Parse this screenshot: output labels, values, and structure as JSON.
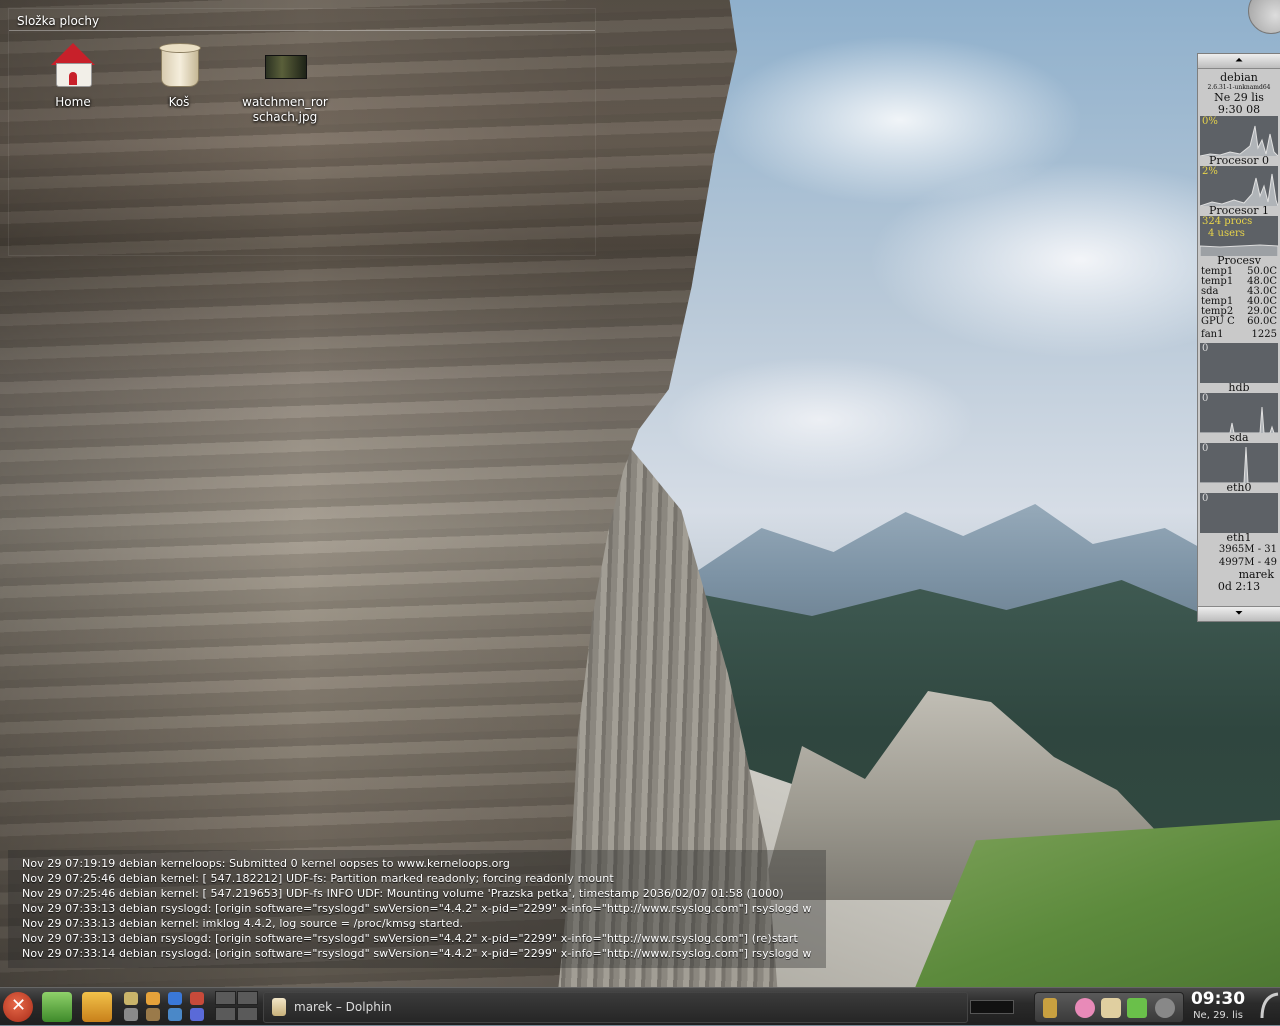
{
  "desktop": {
    "folderview_title": "Složka plochy",
    "icons": [
      {
        "label": "Home",
        "icon": "home-icon"
      },
      {
        "label": "Koš",
        "icon": "trash-icon"
      },
      {
        "label": "watchmen_rorschach.jpg",
        "icon": "image-file-icon"
      }
    ]
  },
  "monitor": {
    "hostname": "debian",
    "kernel": "2.6.31-1-unknamd64",
    "date": "Ne 29 lis",
    "time": "9:30 08",
    "cpu0_percent": "0%",
    "cpu0_caption": "Procesor 0",
    "cpu1_percent": "2%",
    "cpu1_caption": "Procesor 1",
    "procs": "324 procs",
    "users": "4 users",
    "procs_caption": "Procesv",
    "sensors": [
      {
        "name": "temp1",
        "value": "50.0C"
      },
      {
        "name": "temp1",
        "value": "48.0C"
      },
      {
        "name": "sda",
        "value": "43.0C"
      },
      {
        "name": "temp1",
        "value": "40.0C"
      },
      {
        "name": "temp2",
        "value": "29.0C"
      },
      {
        "name": "GPU C",
        "value": "60.0C"
      },
      {
        "name": "fan1",
        "value": "1225"
      }
    ],
    "graph_hdb_value": "0",
    "graph_hdb_caption": "hdb",
    "graph_sda_value": "0",
    "graph_sda_caption": "sda",
    "graph_eth0_value": "0",
    "graph_eth0_caption": "eth0",
    "graph_eth1_value": "0",
    "graph_eth1_caption": "eth1",
    "mem1": "3965M - 31",
    "mem2": "4997M - 49",
    "user": "marek",
    "uptime": "0d  2:13"
  },
  "log": {
    "lines": [
      "Nov 29 07:19:19 debian kerneloops: Submitted 0 kernel oopses to www.kerneloops.org",
      "Nov 29 07:25:46 debian kernel: [  547.182212] UDF-fs: Partition marked readonly; forcing readonly mount",
      "Nov 29 07:25:46 debian kernel: [  547.219653] UDF-fs INFO UDF: Mounting volume 'Prazska petka', timestamp 2036/02/07 01:58 (1000)",
      "Nov 29 07:33:13 debian rsyslogd: [origin software=\"rsyslogd\" swVersion=\"4.4.2\" x-pid=\"2299\" x-info=\"http://www.rsyslog.com\"] rsyslogd w",
      "Nov 29 07:33:13 debian kernel: imklog 4.4.2, log source = /proc/kmsg started.",
      "Nov 29 07:33:13 debian rsyslogd: [origin software=\"rsyslogd\" swVersion=\"4.4.2\" x-pid=\"2299\" x-info=\"http://www.rsyslog.com\"] (re)start",
      "Nov 29 07:33:14 debian rsyslogd: [origin software=\"rsyslogd\" swVersion=\"4.4.2\" x-pid=\"2299\" x-info=\"http://www.rsyslog.com\"] rsyslogd w"
    ]
  },
  "taskbar": {
    "task_label": "marek – Dolphin",
    "clock_time": "09:30",
    "clock_date": "Ne, 29. lis"
  },
  "colors": {
    "graph_bg": "#5d6166",
    "graph_label": "#e8d44a",
    "monitor_bg": "#c9c9c9",
    "taskbar_bg": "#2b2b2b"
  }
}
